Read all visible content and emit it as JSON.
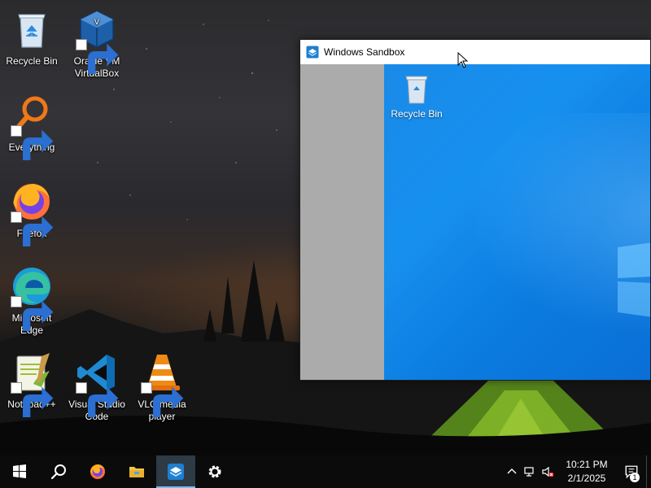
{
  "desktop": {
    "icons": [
      {
        "label": "Recycle Bin",
        "icon": "recycle-bin-icon"
      },
      {
        "label": "Oracle VM\nVirtualBox",
        "icon": "virtualbox-icon"
      },
      {
        "label": "Everything",
        "icon": "everything-search-icon"
      },
      {
        "label": "Firefox",
        "icon": "firefox-icon"
      },
      {
        "label": "Microsoft\nEdge",
        "icon": "edge-icon"
      },
      {
        "label": "Notepad++",
        "icon": "notepadpp-icon"
      },
      {
        "label": "Visual Studio\nCode",
        "icon": "vscode-icon"
      },
      {
        "label": "VLC media\nplayer",
        "icon": "vlc-icon"
      }
    ]
  },
  "sandbox_window": {
    "title": "Windows Sandbox",
    "inner_desktop": {
      "recycle_label": "Recycle Bin"
    }
  },
  "taskbar": {
    "buttons": [
      "start-icon",
      "search-icon",
      "firefox-icon",
      "file-explorer-icon",
      "windows-sandbox-icon",
      "settings-icon"
    ],
    "tray": {
      "time": "10:21 PM",
      "date": "2/1/2025",
      "notification_count": "1"
    }
  },
  "colors": {
    "taskbar_bg": "#0b0b0b",
    "sandbox_desktop_blue": "#1690ef",
    "active_indicator": "#76b9ed"
  }
}
